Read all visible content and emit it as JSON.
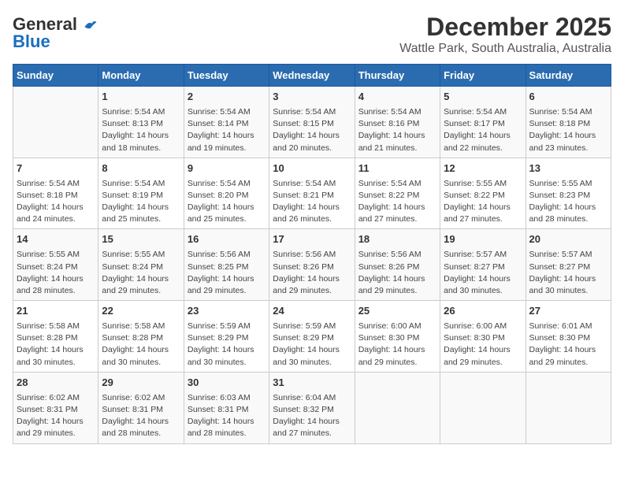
{
  "logo": {
    "line1": "General",
    "line2": "Blue"
  },
  "title": "December 2025",
  "subtitle": "Wattle Park, South Australia, Australia",
  "headers": [
    "Sunday",
    "Monday",
    "Tuesday",
    "Wednesday",
    "Thursday",
    "Friday",
    "Saturday"
  ],
  "weeks": [
    [
      {
        "day": "",
        "content": ""
      },
      {
        "day": "1",
        "content": "Sunrise: 5:54 AM\nSunset: 8:13 PM\nDaylight: 14 hours\nand 18 minutes."
      },
      {
        "day": "2",
        "content": "Sunrise: 5:54 AM\nSunset: 8:14 PM\nDaylight: 14 hours\nand 19 minutes."
      },
      {
        "day": "3",
        "content": "Sunrise: 5:54 AM\nSunset: 8:15 PM\nDaylight: 14 hours\nand 20 minutes."
      },
      {
        "day": "4",
        "content": "Sunrise: 5:54 AM\nSunset: 8:16 PM\nDaylight: 14 hours\nand 21 minutes."
      },
      {
        "day": "5",
        "content": "Sunrise: 5:54 AM\nSunset: 8:17 PM\nDaylight: 14 hours\nand 22 minutes."
      },
      {
        "day": "6",
        "content": "Sunrise: 5:54 AM\nSunset: 8:18 PM\nDaylight: 14 hours\nand 23 minutes."
      }
    ],
    [
      {
        "day": "7",
        "content": "Sunrise: 5:54 AM\nSunset: 8:18 PM\nDaylight: 14 hours\nand 24 minutes."
      },
      {
        "day": "8",
        "content": "Sunrise: 5:54 AM\nSunset: 8:19 PM\nDaylight: 14 hours\nand 25 minutes."
      },
      {
        "day": "9",
        "content": "Sunrise: 5:54 AM\nSunset: 8:20 PM\nDaylight: 14 hours\nand 25 minutes."
      },
      {
        "day": "10",
        "content": "Sunrise: 5:54 AM\nSunset: 8:21 PM\nDaylight: 14 hours\nand 26 minutes."
      },
      {
        "day": "11",
        "content": "Sunrise: 5:54 AM\nSunset: 8:22 PM\nDaylight: 14 hours\nand 27 minutes."
      },
      {
        "day": "12",
        "content": "Sunrise: 5:55 AM\nSunset: 8:22 PM\nDaylight: 14 hours\nand 27 minutes."
      },
      {
        "day": "13",
        "content": "Sunrise: 5:55 AM\nSunset: 8:23 PM\nDaylight: 14 hours\nand 28 minutes."
      }
    ],
    [
      {
        "day": "14",
        "content": "Sunrise: 5:55 AM\nSunset: 8:24 PM\nDaylight: 14 hours\nand 28 minutes."
      },
      {
        "day": "15",
        "content": "Sunrise: 5:55 AM\nSunset: 8:24 PM\nDaylight: 14 hours\nand 29 minutes."
      },
      {
        "day": "16",
        "content": "Sunrise: 5:56 AM\nSunset: 8:25 PM\nDaylight: 14 hours\nand 29 minutes."
      },
      {
        "day": "17",
        "content": "Sunrise: 5:56 AM\nSunset: 8:26 PM\nDaylight: 14 hours\nand 29 minutes."
      },
      {
        "day": "18",
        "content": "Sunrise: 5:56 AM\nSunset: 8:26 PM\nDaylight: 14 hours\nand 29 minutes."
      },
      {
        "day": "19",
        "content": "Sunrise: 5:57 AM\nSunset: 8:27 PM\nDaylight: 14 hours\nand 30 minutes."
      },
      {
        "day": "20",
        "content": "Sunrise: 5:57 AM\nSunset: 8:27 PM\nDaylight: 14 hours\nand 30 minutes."
      }
    ],
    [
      {
        "day": "21",
        "content": "Sunrise: 5:58 AM\nSunset: 8:28 PM\nDaylight: 14 hours\nand 30 minutes."
      },
      {
        "day": "22",
        "content": "Sunrise: 5:58 AM\nSunset: 8:28 PM\nDaylight: 14 hours\nand 30 minutes."
      },
      {
        "day": "23",
        "content": "Sunrise: 5:59 AM\nSunset: 8:29 PM\nDaylight: 14 hours\nand 30 minutes."
      },
      {
        "day": "24",
        "content": "Sunrise: 5:59 AM\nSunset: 8:29 PM\nDaylight: 14 hours\nand 30 minutes."
      },
      {
        "day": "25",
        "content": "Sunrise: 6:00 AM\nSunset: 8:30 PM\nDaylight: 14 hours\nand 29 minutes."
      },
      {
        "day": "26",
        "content": "Sunrise: 6:00 AM\nSunset: 8:30 PM\nDaylight: 14 hours\nand 29 minutes."
      },
      {
        "day": "27",
        "content": "Sunrise: 6:01 AM\nSunset: 8:30 PM\nDaylight: 14 hours\nand 29 minutes."
      }
    ],
    [
      {
        "day": "28",
        "content": "Sunrise: 6:02 AM\nSunset: 8:31 PM\nDaylight: 14 hours\nand 29 minutes."
      },
      {
        "day": "29",
        "content": "Sunrise: 6:02 AM\nSunset: 8:31 PM\nDaylight: 14 hours\nand 28 minutes."
      },
      {
        "day": "30",
        "content": "Sunrise: 6:03 AM\nSunset: 8:31 PM\nDaylight: 14 hours\nand 28 minutes."
      },
      {
        "day": "31",
        "content": "Sunrise: 6:04 AM\nSunset: 8:32 PM\nDaylight: 14 hours\nand 27 minutes."
      },
      {
        "day": "",
        "content": ""
      },
      {
        "day": "",
        "content": ""
      },
      {
        "day": "",
        "content": ""
      }
    ]
  ]
}
